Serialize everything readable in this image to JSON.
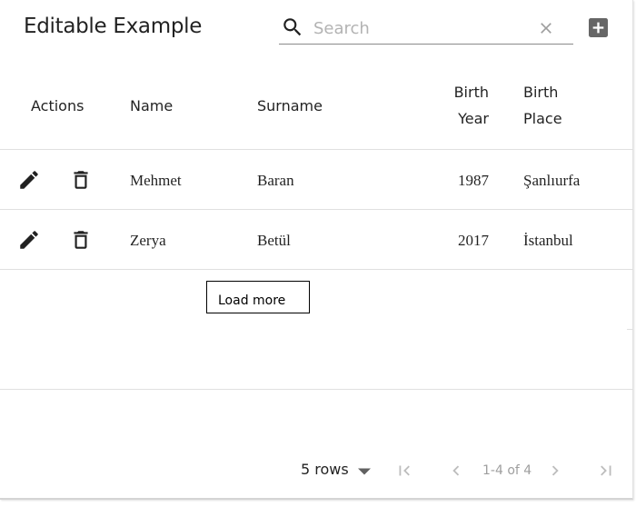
{
  "toolbar": {
    "title": "Editable Example",
    "search_placeholder": "Search",
    "search_value": ""
  },
  "table": {
    "headers": {
      "actions": "Actions",
      "name": "Name",
      "surname": "Surname",
      "birth_year_1": "Birth",
      "birth_year_2": "Year",
      "birth_place_1": "Birth",
      "birth_place_2": "Place"
    },
    "rows": [
      {
        "name": "Mehmet",
        "surname": "Baran",
        "birth_year": "1987",
        "birth_place": "Şanlıurfa"
      },
      {
        "name": "Zerya",
        "surname": "Betül",
        "birth_year": "2017",
        "birth_place": "İstanbul"
      }
    ],
    "load_more_label": "Load more"
  },
  "pagination": {
    "rows_per_page": "5 rows",
    "page_info": "1-4 of 4"
  },
  "icons": {
    "search": "search-icon",
    "clear": "close-icon",
    "add": "add-box-icon",
    "edit": "pencil-icon",
    "delete": "trash-icon",
    "first_page": "first-page-icon",
    "prev_page": "chevron-left-icon",
    "next_page": "chevron-right-icon",
    "last_page": "last-page-icon",
    "dropdown": "arrow-drop-down-icon"
  },
  "colors": {
    "text": "#212121",
    "muted": "#9e9e9e",
    "divider": "#e0e0e0"
  }
}
